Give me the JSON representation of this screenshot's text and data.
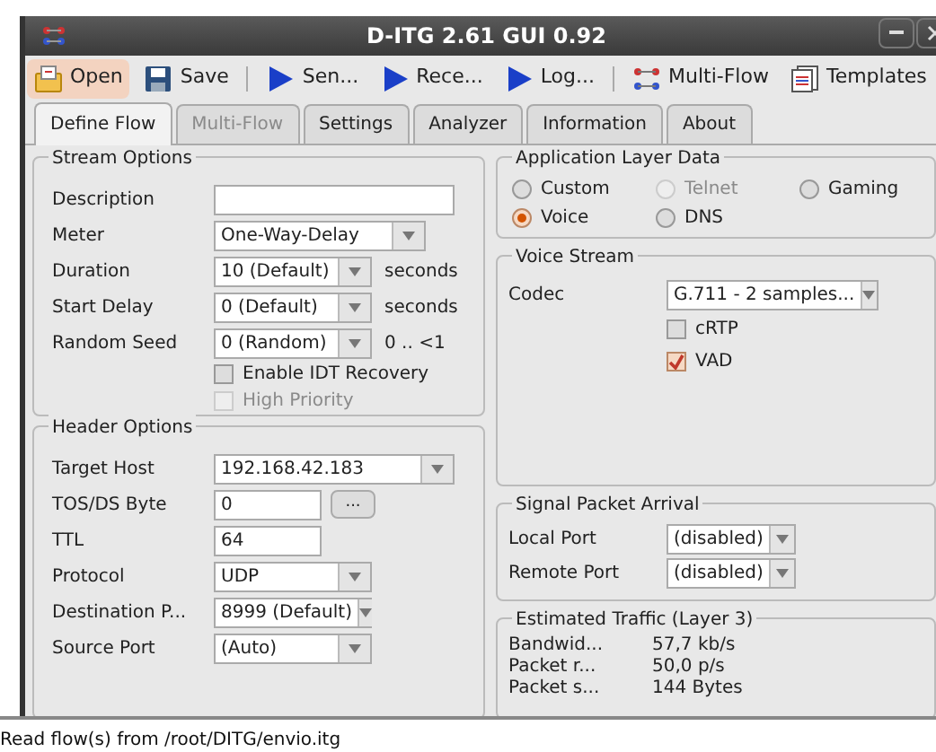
{
  "window": {
    "title": "D-ITG 2.61 GUI 0.92"
  },
  "toolbar": [
    {
      "kind": "folder",
      "label": "Open",
      "highlighted": true
    },
    {
      "kind": "floppy",
      "label": "Save",
      "highlighted": false
    },
    {
      "kind": "separator"
    },
    {
      "kind": "play",
      "label": "Sen...",
      "highlighted": false
    },
    {
      "kind": "play",
      "label": "Rece...",
      "highlighted": false
    },
    {
      "kind": "play",
      "label": "Log...",
      "highlighted": false
    },
    {
      "kind": "separator"
    },
    {
      "kind": "flows",
      "label": "Multi-Flow",
      "highlighted": false
    },
    {
      "kind": "templates",
      "label": "Templates",
      "highlighted": false
    }
  ],
  "tabs": [
    {
      "label": "Define Flow",
      "selected": true,
      "disabled": false
    },
    {
      "label": "Multi-Flow",
      "selected": false,
      "disabled": true
    },
    {
      "label": "Settings",
      "selected": false,
      "disabled": false
    },
    {
      "label": "Analyzer",
      "selected": false,
      "disabled": false
    },
    {
      "label": "Information",
      "selected": false,
      "disabled": false
    },
    {
      "label": "About",
      "selected": false,
      "disabled": false
    }
  ],
  "stream_options": {
    "title": "Stream Options",
    "rows": [
      {
        "kind": "text",
        "label": "Description",
        "value": ""
      },
      {
        "kind": "combo",
        "label": "Meter",
        "value": "One-Way-Delay"
      },
      {
        "kind": "combo",
        "label": "Duration",
        "value": "10 (Default)",
        "unit": "seconds"
      },
      {
        "kind": "combo",
        "label": "Start Delay",
        "value": "0 (Default)",
        "unit": "seconds"
      },
      {
        "kind": "combo",
        "label": "Random Seed",
        "value": "0 (Random)",
        "unit": "0 .. <1"
      }
    ],
    "checks": [
      {
        "label": "Enable IDT Recovery",
        "checked": false,
        "disabled": false
      },
      {
        "label": "High Priority",
        "checked": false,
        "disabled": true
      }
    ]
  },
  "header_options": {
    "title": "Header Options",
    "rows": [
      {
        "kind": "combo_wide",
        "label": "Target Host",
        "value": "192.168.42.183"
      },
      {
        "kind": "text_button",
        "label": "TOS/DS Byte",
        "value": "0",
        "button": "..."
      },
      {
        "kind": "text",
        "label": "TTL",
        "value": "64"
      },
      {
        "kind": "combo",
        "label": "Protocol",
        "value": "UDP"
      },
      {
        "kind": "combo",
        "label": "Destination P...",
        "value": "8999 (Default)"
      },
      {
        "kind": "combo",
        "label": "Source Port",
        "value": "(Auto)"
      }
    ]
  },
  "application_layer": {
    "title": "Application Layer Data",
    "options": [
      {
        "label": "Custom",
        "selected": false,
        "disabled": false
      },
      {
        "label": "Telnet",
        "selected": false,
        "disabled": true
      },
      {
        "label": "Gaming",
        "selected": false,
        "disabled": false
      },
      {
        "label": "Voice",
        "selected": true,
        "disabled": false
      },
      {
        "label": "DNS",
        "selected": false,
        "disabled": false
      }
    ]
  },
  "voice_stream": {
    "title": "Voice Stream",
    "codec_label": "Codec",
    "codec": "G.711 - 2 samples...",
    "checks": [
      {
        "label": "cRTP",
        "checked": false
      },
      {
        "label": "VAD",
        "checked": true
      }
    ]
  },
  "signal_packet_arrival": {
    "title": "Signal Packet Arrival",
    "rows": [
      {
        "label": "Local Port",
        "value": "(disabled)"
      },
      {
        "label": "Remote Port",
        "value": "(disabled)"
      }
    ]
  },
  "estimated_traffic": {
    "title": "Estimated Traffic (Layer 3)",
    "rows": [
      {
        "label": "Bandwid...",
        "value": "57,7 kb/s"
      },
      {
        "label": "Packet r...",
        "value": "50,0 p/s"
      },
      {
        "label": "Packet s...",
        "value": "144 Bytes"
      }
    ]
  },
  "status_bar": "Read flow(s) from /root/DITG/envio.itg"
}
